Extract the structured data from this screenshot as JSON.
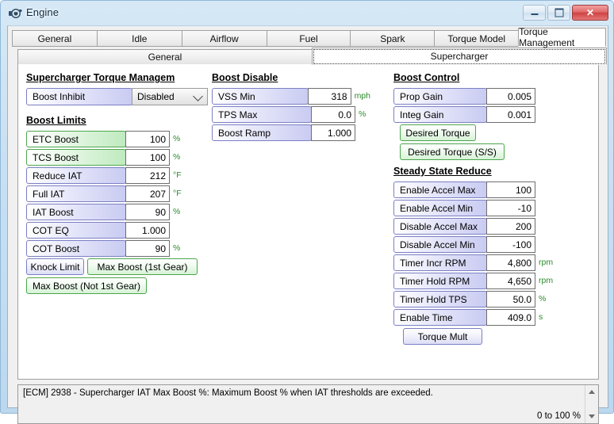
{
  "window": {
    "title": "Engine",
    "icon": "engine-gauge-icon",
    "buttons": {
      "minimize": "minimize-icon",
      "maximize": "maximize-icon",
      "close": "✕"
    }
  },
  "tabs": {
    "primary": [
      {
        "label": "General",
        "active": false
      },
      {
        "label": "Idle",
        "active": false
      },
      {
        "label": "Airflow",
        "active": false
      },
      {
        "label": "Fuel",
        "active": false
      },
      {
        "label": "Spark",
        "active": false
      },
      {
        "label": "Torque Model",
        "active": false
      },
      {
        "label": "Torque Management",
        "active": true
      }
    ],
    "secondary": [
      {
        "label": "General",
        "active": false
      },
      {
        "label": "Supercharger",
        "active": true
      }
    ]
  },
  "groups": {
    "supercharger_torque_management": {
      "title": "Supercharger Torque Managem",
      "boost_inhibit": {
        "label": "Boost Inhibit",
        "value": "Disabled"
      }
    },
    "boost_limits": {
      "title": "Boost Limits",
      "rows": [
        {
          "label": "ETC Boost",
          "value": "100",
          "unit": "%",
          "style": "green"
        },
        {
          "label": "TCS Boost",
          "value": "100",
          "unit": "%",
          "style": "green"
        },
        {
          "label": "Reduce IAT",
          "value": "212",
          "unit": "°F",
          "style": "blue"
        },
        {
          "label": "Full IAT",
          "value": "207",
          "unit": "°F",
          "style": "blue"
        },
        {
          "label": "IAT Boost",
          "value": "90",
          "unit": "%",
          "style": "blue"
        },
        {
          "label": "COT EQ",
          "value": "1.000",
          "unit": "",
          "style": "blue"
        },
        {
          "label": "COT Boost",
          "value": "90",
          "unit": "%",
          "style": "blue"
        }
      ],
      "buttons": [
        {
          "label": "Knock Limit",
          "style": "blue"
        },
        {
          "label": "Max Boost (1st Gear)",
          "style": "green"
        },
        {
          "label": "Max Boost (Not 1st Gear)",
          "style": "green"
        }
      ]
    },
    "boost_disable": {
      "title": "Boost Disable",
      "rows": [
        {
          "label": "VSS Min",
          "value": "318",
          "unit": "mph",
          "style": "blue"
        },
        {
          "label": "TPS Max",
          "value": "0.0",
          "unit": "%",
          "style": "blue"
        },
        {
          "label": "Boost Ramp",
          "value": "1.000",
          "unit": "",
          "style": "blue"
        }
      ]
    },
    "boost_control": {
      "title": "Boost Control",
      "rows": [
        {
          "label": "Prop Gain",
          "value": "0.005",
          "unit": "",
          "style": "blue"
        },
        {
          "label": "Integ Gain",
          "value": "0.001",
          "unit": "",
          "style": "blue"
        }
      ],
      "buttons": [
        {
          "label": "Desired Torque",
          "style": "green"
        },
        {
          "label": "Desired Torque (S/S)",
          "style": "green"
        }
      ]
    },
    "steady_state_reduce": {
      "title": "Steady State Reduce",
      "rows": [
        {
          "label": "Enable Accel Max",
          "value": "100",
          "unit": "",
          "style": "blue"
        },
        {
          "label": "Enable Accel Min",
          "value": "-10",
          "unit": "",
          "style": "blue"
        },
        {
          "label": "Disable Accel Max",
          "value": "200",
          "unit": "",
          "style": "blue"
        },
        {
          "label": "Disable Accel Min",
          "value": "-100",
          "unit": "",
          "style": "blue"
        },
        {
          "label": "Timer Incr RPM",
          "value": "4,800",
          "unit": "rpm",
          "style": "blue"
        },
        {
          "label": "Timer Hold RPM",
          "value": "4,650",
          "unit": "rpm",
          "style": "blue"
        },
        {
          "label": "Timer Hold TPS",
          "value": "50.0",
          "unit": "%",
          "style": "blue"
        },
        {
          "label": "Enable Time",
          "value": "409.0",
          "unit": "s",
          "style": "blue"
        }
      ],
      "buttons": [
        {
          "label": "Torque Mult",
          "style": "blue"
        }
      ]
    }
  },
  "help": {
    "description": "[ECM] 2938 - Supercharger IAT Max Boost %: Maximum Boost % when IAT thresholds are exceeded.",
    "range": "0 to 100 %"
  },
  "colors": {
    "accent_blue": "#7b7fc4",
    "accent_green": "#4ca64c",
    "unit_green": "#2a8a2a",
    "titlebar": "#c9e0f2",
    "close_red": "#cf4242"
  }
}
